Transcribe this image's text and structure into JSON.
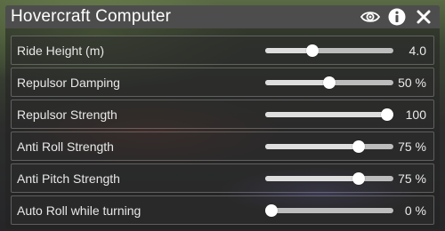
{
  "window": {
    "title": "Hovercraft Computer",
    "icons": [
      "eye-icon",
      "info-icon",
      "close-icon"
    ]
  },
  "settings": [
    {
      "label": "Ride Height (m)",
      "value_text": "4.0",
      "level": 0.35
    },
    {
      "label": "Repulsor Damping",
      "value_text": "50 %",
      "level": 0.5
    },
    {
      "label": "Repulsor Strength",
      "value_text": "100",
      "level": 1.0
    },
    {
      "label": "Anti Roll Strength",
      "value_text": "75 %",
      "level": 0.75
    },
    {
      "label": "Anti Pitch Strength",
      "value_text": "75 %",
      "level": 0.75
    },
    {
      "label": "Auto Roll while turning",
      "value_text": "0 %",
      "level": 0.0
    }
  ],
  "colors": {
    "titlebar": "#4d4d4d",
    "track": "#bdbdbd",
    "thumb": "#ffffff",
    "text": "#e8e8e8"
  }
}
